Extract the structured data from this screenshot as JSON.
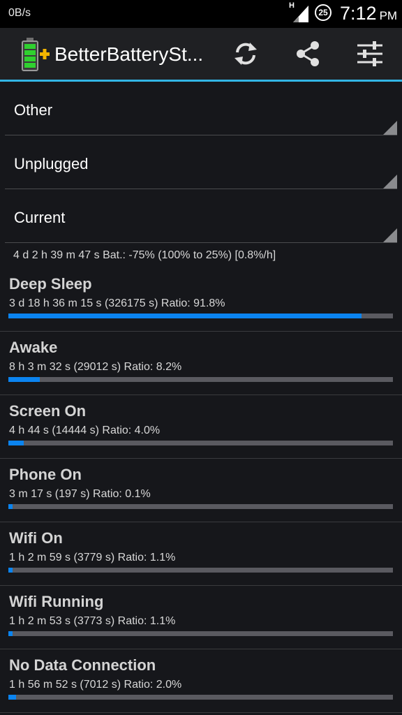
{
  "status_bar": {
    "speed": "0B/s",
    "network_type": "H",
    "battery_level": "25",
    "time": "7:12",
    "ampm": "PM"
  },
  "action_bar": {
    "title": "BetterBatterySt...",
    "actions": [
      "refresh-icon",
      "share-icon",
      "settings-sliders-icon"
    ]
  },
  "filters": {
    "category": "Other",
    "reference": "Unplugged",
    "to": "Current"
  },
  "summary": "4 d 2 h 39 m 47 s  Bat.: -75% (100% to 25%) [0.8%/h]",
  "stats": [
    {
      "name": "Deep Sleep",
      "detail": "3 d 18 h 36 m 15 s  (326175 s) Ratio: 91.8%",
      "ratio": 91.8
    },
    {
      "name": "Awake",
      "detail": "8 h 3 m 32 s  (29012 s) Ratio: 8.2%",
      "ratio": 8.2
    },
    {
      "name": "Screen On",
      "detail": "4 h 44 s  (14444 s) Ratio: 4.0%",
      "ratio": 4.0
    },
    {
      "name": "Phone On",
      "detail": "3 m 17 s  (197 s) Ratio: 0.1%",
      "ratio": 0.1
    },
    {
      "name": "Wifi On",
      "detail": "1 h 2 m 59 s  (3779 s) Ratio: 1.1%",
      "ratio": 1.1
    },
    {
      "name": "Wifi Running",
      "detail": "1 h 2 m 53 s  (3773 s) Ratio: 1.1%",
      "ratio": 1.1
    },
    {
      "name": "No Data Connection",
      "detail": "1 h 56 m 52 s  (7012 s) Ratio: 2.0%",
      "ratio": 2.0
    }
  ],
  "colors": {
    "accent": "#33b5e5",
    "bar_fill": "#0b84f0",
    "bar_track": "#5a5a60",
    "background": "#16171b"
  }
}
